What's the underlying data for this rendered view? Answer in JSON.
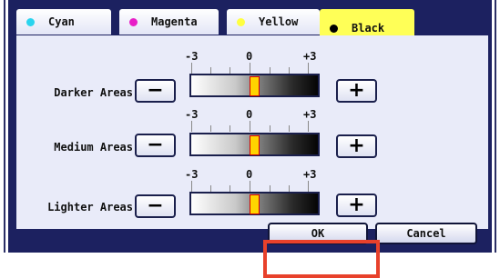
{
  "tabs": [
    {
      "label": "Cyan",
      "dot_color": "#2ad4ee",
      "active": false
    },
    {
      "label": "Magenta",
      "dot_color": "#e81ec7",
      "active": false
    },
    {
      "label": "Yellow",
      "dot_color": "#ffff40",
      "active": false
    },
    {
      "label": "Black",
      "dot_color": "#000000",
      "active": true
    }
  ],
  "scale": {
    "min": "-3",
    "mid": "0",
    "max": "+3"
  },
  "rows": [
    {
      "label": "Darker Areas",
      "value": 0,
      "minus": "−",
      "plus": "+"
    },
    {
      "label": "Medium Areas",
      "value": 0,
      "minus": "−",
      "plus": "+"
    },
    {
      "label": "Lighter Areas",
      "value": 0,
      "minus": "−",
      "plus": "+"
    }
  ],
  "footer": {
    "ok_label": "OK",
    "cancel_label": "Cancel"
  },
  "colors": {
    "frame": "#1c2160",
    "content_bg": "#e9ebf9",
    "active_tab": "#ffff57",
    "highlight": "#e8412b",
    "thumb": "#ffd400"
  }
}
